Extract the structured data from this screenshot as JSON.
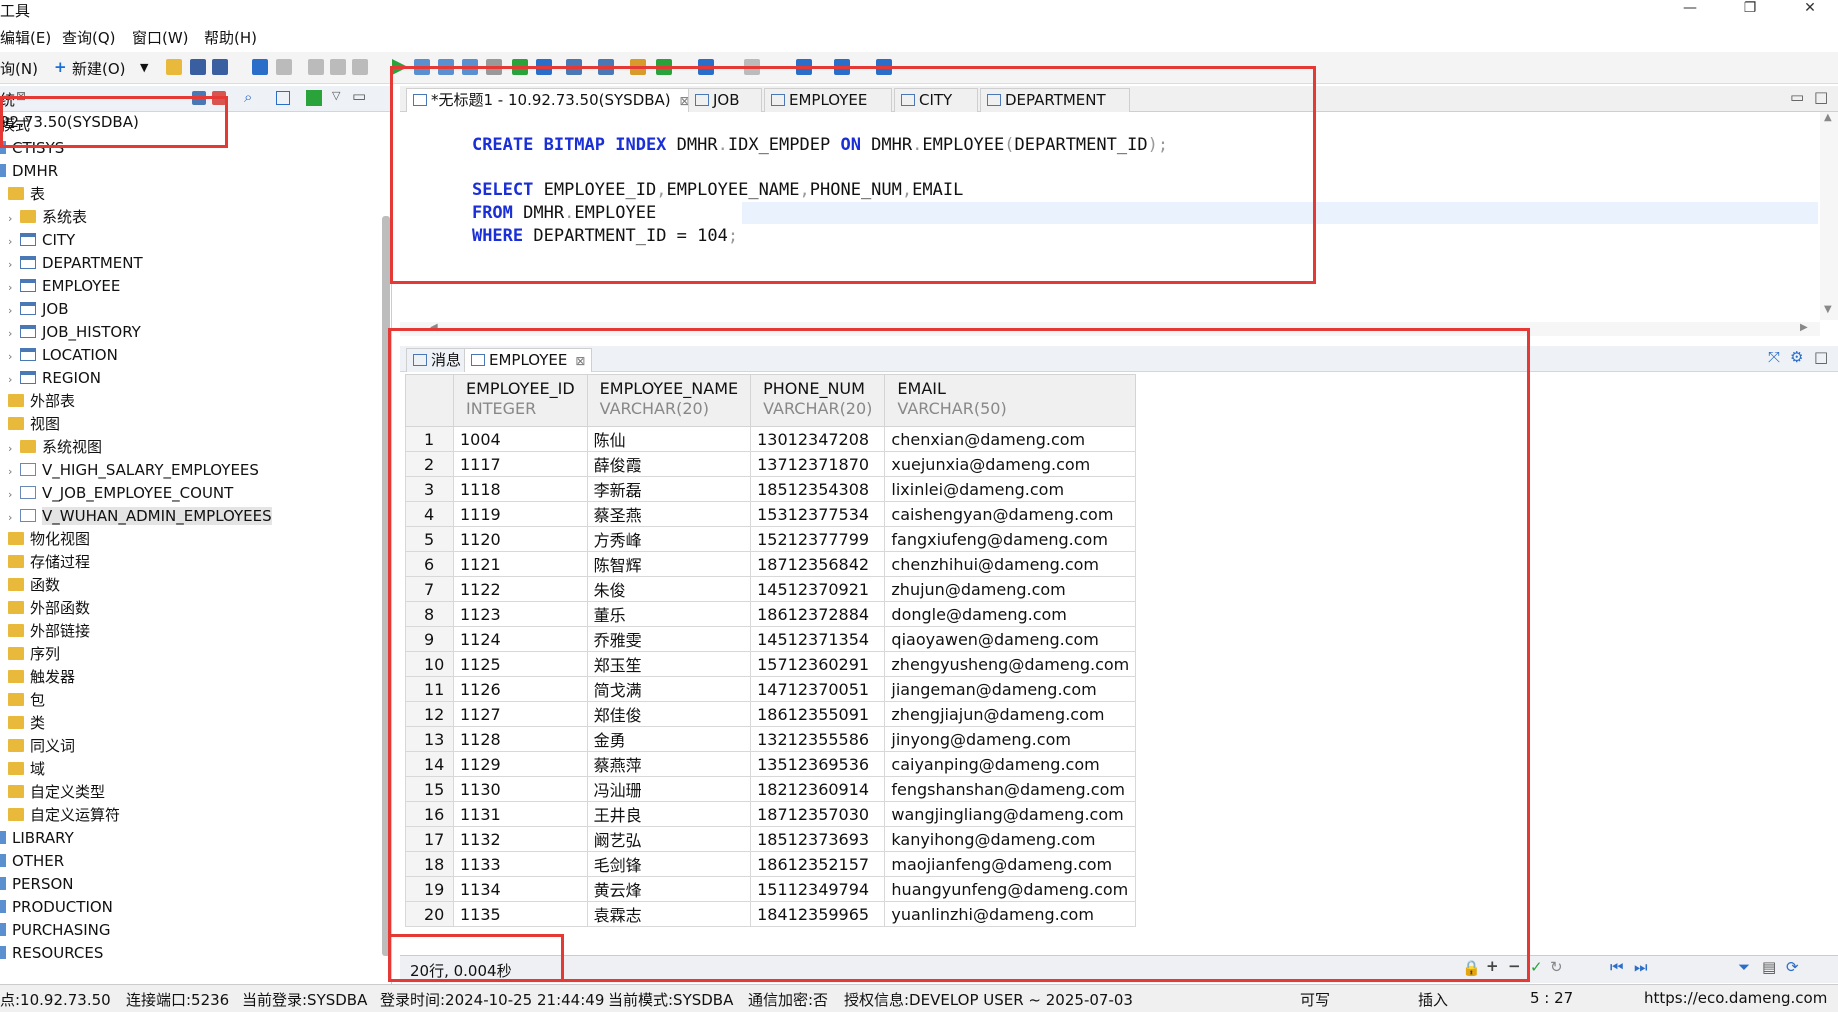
{
  "titlebar": {
    "title": "工具"
  },
  "menu": [
    "编辑(E)",
    "查询(Q)",
    "窗口(W)",
    "帮助(H)"
  ],
  "toolbar": {
    "query_label": "询(N)",
    "new_label": "新建(O)"
  },
  "left_panel": {
    "tab_label": "统",
    "connection": "92.73.50(SYSDBA)"
  },
  "tree": [
    {
      "label": "模式",
      "indent": 0,
      "icon": "none"
    },
    {
      "label": "CTISYS",
      "indent": 0,
      "icon": "schema"
    },
    {
      "label": "DMHR",
      "indent": 0,
      "icon": "schema"
    },
    {
      "label": "表",
      "indent": 1,
      "icon": "folder"
    },
    {
      "label": "系统表",
      "indent": 2,
      "icon": "folder",
      "arrow": true
    },
    {
      "label": "CITY",
      "indent": 2,
      "icon": "table",
      "arrow": true
    },
    {
      "label": "DEPARTMENT",
      "indent": 2,
      "icon": "table",
      "arrow": true
    },
    {
      "label": "EMPLOYEE",
      "indent": 2,
      "icon": "table",
      "arrow": true
    },
    {
      "label": "JOB",
      "indent": 2,
      "icon": "table",
      "arrow": true
    },
    {
      "label": "JOB_HISTORY",
      "indent": 2,
      "icon": "table",
      "arrow": true
    },
    {
      "label": "LOCATION",
      "indent": 2,
      "icon": "table",
      "arrow": true
    },
    {
      "label": "REGION",
      "indent": 2,
      "icon": "table",
      "arrow": true
    },
    {
      "label": "外部表",
      "indent": 1,
      "icon": "folder"
    },
    {
      "label": "视图",
      "indent": 1,
      "icon": "folder"
    },
    {
      "label": "系统视图",
      "indent": 2,
      "icon": "folder",
      "arrow": true
    },
    {
      "label": "V_HIGH_SALARY_EMPLOYEES",
      "indent": 2,
      "icon": "view",
      "arrow": true
    },
    {
      "label": "V_JOB_EMPLOYEE_COUNT",
      "indent": 2,
      "icon": "view",
      "arrow": true
    },
    {
      "label": "V_WUHAN_ADMIN_EMPLOYEES",
      "indent": 2,
      "icon": "view",
      "arrow": true,
      "selected": true
    },
    {
      "label": "物化视图",
      "indent": 1,
      "icon": "folder"
    },
    {
      "label": "存储过程",
      "indent": 1,
      "icon": "folder"
    },
    {
      "label": "函数",
      "indent": 1,
      "icon": "folder"
    },
    {
      "label": "外部函数",
      "indent": 1,
      "icon": "folder"
    },
    {
      "label": "外部链接",
      "indent": 1,
      "icon": "folder"
    },
    {
      "label": "序列",
      "indent": 1,
      "icon": "folder"
    },
    {
      "label": "触发器",
      "indent": 1,
      "icon": "folder"
    },
    {
      "label": "包",
      "indent": 1,
      "icon": "folder"
    },
    {
      "label": "类",
      "indent": 1,
      "icon": "folder"
    },
    {
      "label": "同义词",
      "indent": 1,
      "icon": "folder"
    },
    {
      "label": "域",
      "indent": 1,
      "icon": "folder"
    },
    {
      "label": "自定义类型",
      "indent": 1,
      "icon": "folder"
    },
    {
      "label": "自定义运算符",
      "indent": 1,
      "icon": "folder"
    },
    {
      "label": "LIBRARY",
      "indent": 0,
      "icon": "schema"
    },
    {
      "label": "OTHER",
      "indent": 0,
      "icon": "schema"
    },
    {
      "label": "PERSON",
      "indent": 0,
      "icon": "schema"
    },
    {
      "label": "PRODUCTION",
      "indent": 0,
      "icon": "schema"
    },
    {
      "label": "PURCHASING",
      "indent": 0,
      "icon": "schema"
    },
    {
      "label": "RESOURCES",
      "indent": 0,
      "icon": "schema"
    }
  ],
  "editor_tabs": [
    "*无标题1 - 10.92.73.50(SYSDBA)",
    "JOB",
    "EMPLOYEE",
    "CITY",
    "DEPARTMENT"
  ],
  "sql": {
    "l1": [
      "CREATE BITMAP INDEX",
      " DMHR",
      ".",
      "IDX_EMPDEP ",
      "ON",
      " DMHR",
      ".",
      "EMPLOYEE",
      "(",
      "DEPARTMENT_ID",
      ");"
    ],
    "l3": [
      "SELECT",
      " EMPLOYEE_ID",
      ",",
      "EMPLOYEE_NAME",
      ",",
      "PHONE_NUM",
      ",",
      "EMAIL"
    ],
    "l4": [
      "FROM",
      " DMHR",
      ".",
      "EMPLOYEE"
    ],
    "l5": [
      "WHERE",
      " DEPARTMENT_ID = 104",
      ";"
    ]
  },
  "result_tabs": [
    "消息",
    "EMPLOYEE"
  ],
  "columns": [
    {
      "name": "EMPLOYEE_ID",
      "type": "INTEGER"
    },
    {
      "name": "EMPLOYEE_NAME",
      "type": "VARCHAR(20)"
    },
    {
      "name": "PHONE_NUM",
      "type": "VARCHAR(20)"
    },
    {
      "name": "EMAIL",
      "type": "VARCHAR(50)"
    }
  ],
  "rows": [
    [
      "1",
      "1004",
      "陈仙",
      "13012347208",
      "chenxian@dameng.com"
    ],
    [
      "2",
      "1117",
      "薛俊霞",
      "13712371870",
      "xuejunxia@dameng.com"
    ],
    [
      "3",
      "1118",
      "李新磊",
      "18512354308",
      "lixinlei@dameng.com"
    ],
    [
      "4",
      "1119",
      "蔡圣燕",
      "15312377534",
      "caishengyan@dameng.com"
    ],
    [
      "5",
      "1120",
      "方秀峰",
      "15212377799",
      "fangxiufeng@dameng.com"
    ],
    [
      "6",
      "1121",
      "陈智辉",
      "18712356842",
      "chenzhihui@dameng.com"
    ],
    [
      "7",
      "1122",
      "朱俊",
      "14512370921",
      "zhujun@dameng.com"
    ],
    [
      "8",
      "1123",
      "董乐",
      "18612372884",
      "dongle@dameng.com"
    ],
    [
      "9",
      "1124",
      "乔雅雯",
      "14512371354",
      "qiaoyawen@dameng.com"
    ],
    [
      "10",
      "1125",
      "郑玉笙",
      "15712360291",
      "zhengyusheng@dameng.com"
    ],
    [
      "11",
      "1126",
      "简戈满",
      "14712370051",
      "jiangeman@dameng.com"
    ],
    [
      "12",
      "1127",
      "郑佳俊",
      "18612355091",
      "zhengjiajun@dameng.com"
    ],
    [
      "13",
      "1128",
      "金勇",
      "13212355586",
      "jinyong@dameng.com"
    ],
    [
      "14",
      "1129",
      "蔡燕萍",
      "13512369536",
      "caiyanping@dameng.com"
    ],
    [
      "15",
      "1130",
      "冯汕珊",
      "18212360914",
      "fengshanshan@dameng.com"
    ],
    [
      "16",
      "1131",
      "王井良",
      "18712357030",
      "wangjingliang@dameng.com"
    ],
    [
      "17",
      "1132",
      "阚艺弘",
      "18512373693",
      "kanyihong@dameng.com"
    ],
    [
      "18",
      "1133",
      "毛剑锋",
      "18612352157",
      "maojianfeng@dameng.com"
    ],
    [
      "19",
      "1134",
      "黄云烽",
      "15112349794",
      "huangyunfeng@dameng.com"
    ],
    [
      "20",
      "1135",
      "袁霖志",
      "18412359965",
      "yuanlinzhi@dameng.com"
    ]
  ],
  "result_footer": "20行, 0.004秒",
  "status": {
    "node": "点:10.92.73.50",
    "port": "连接端口:5236",
    "login": "当前登录:SYSDBA",
    "login_time": "登录时间:2024-10-25 21:44:49",
    "schema": "当前模式:SYSDBA",
    "encrypt": "通信加密:否",
    "license": "授权信息:DEVELOP USER ~ 2025-07-03",
    "writable": "可写",
    "insert": "插入",
    "position": "5 : 27",
    "url": "https://eco.dameng.com"
  },
  "colors": {
    "keyword": "#1a2fd6",
    "highlight_box": "#e53935",
    "folder": "#e8b93a"
  }
}
